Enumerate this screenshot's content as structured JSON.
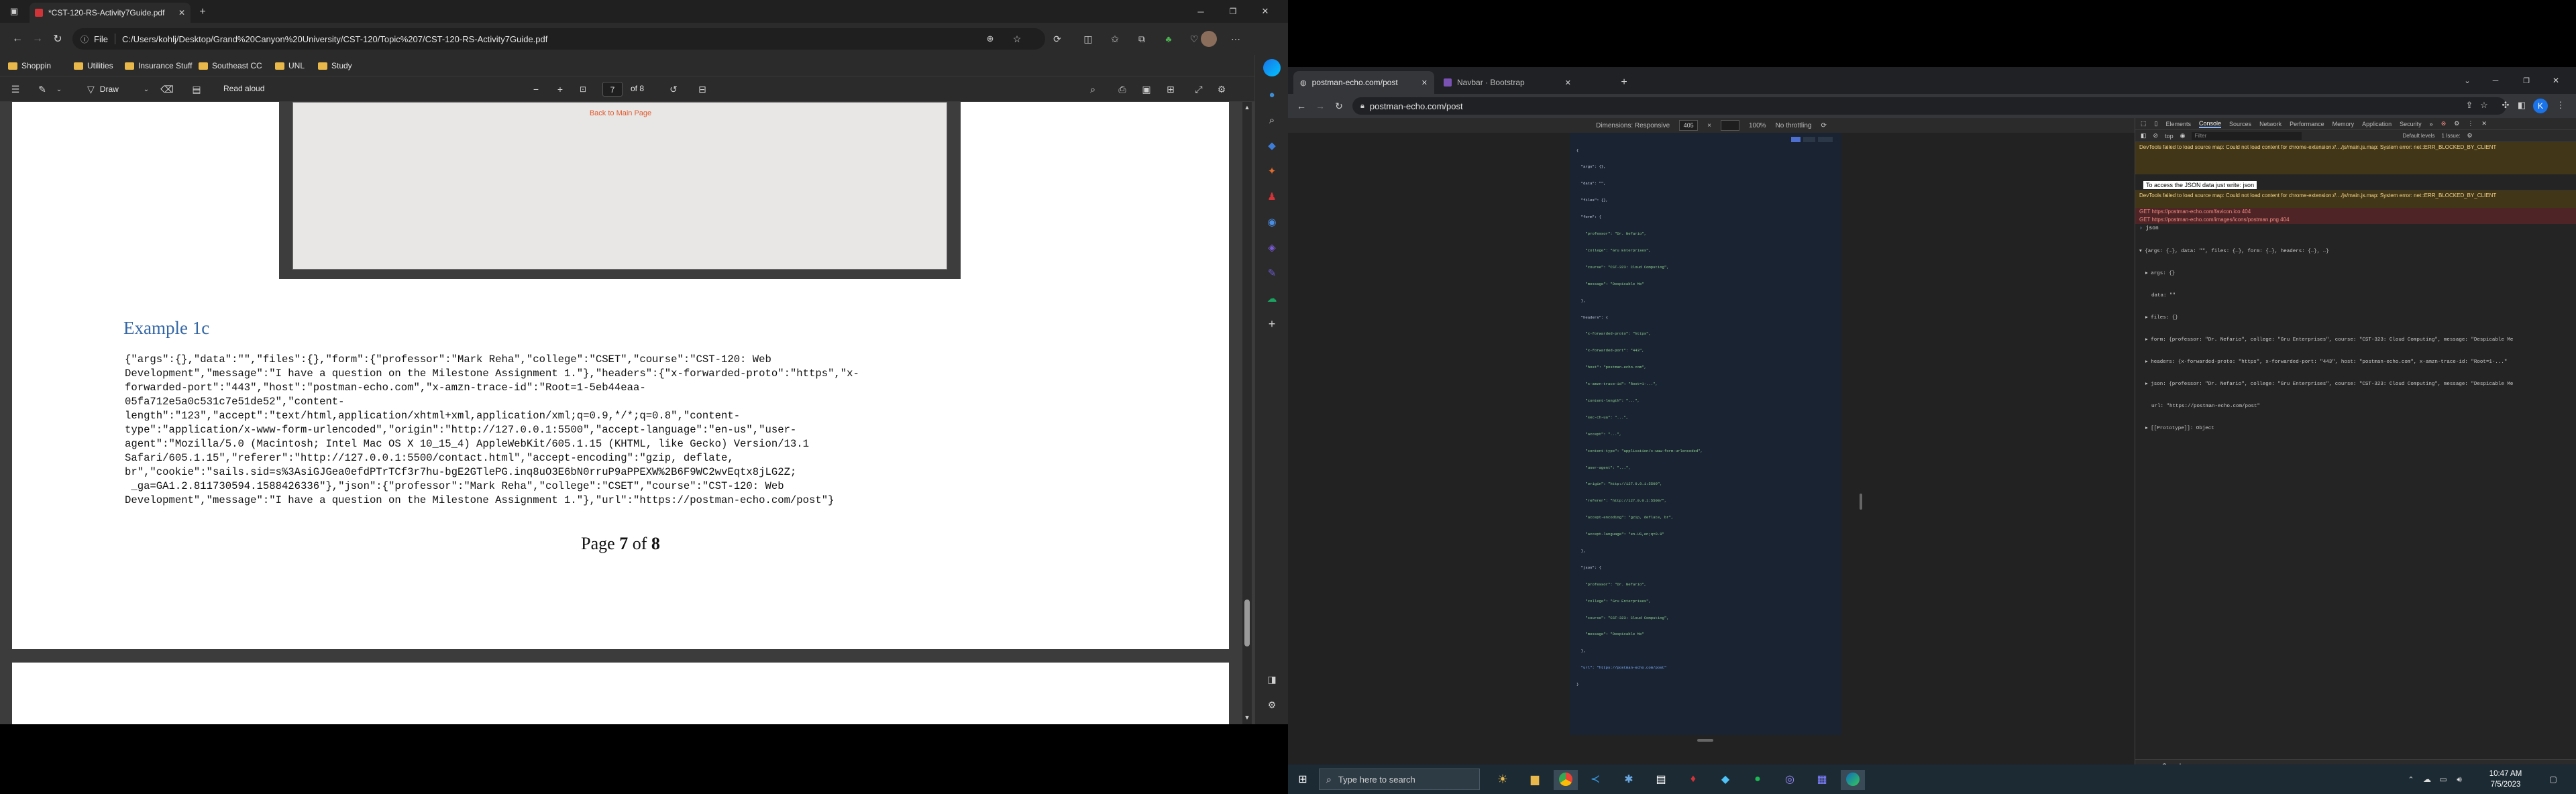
{
  "left": {
    "tab_title": "*CST-120-RS-Activity7Guide.pdf",
    "address_prefix": "File",
    "address": "C:/Users/kohlj/Desktop/Grand%20Canyon%20University/CST-120/Topic%207/CST-120-RS-Activity7Guide.pdf",
    "favorites": [
      "Shoppin",
      "Utilities",
      "Insurance Stuff",
      "Southeast CC",
      "UNL",
      "Study"
    ],
    "pdf_toolbar": {
      "draw_label": "Draw",
      "read_aloud_label": "Read aloud",
      "page_input": "7",
      "page_of": "of 8"
    },
    "embedded_link": "Back to Main Page",
    "example_heading": "Example 1c",
    "json_lines": [
      "{\"args\":{},\"data\":\"\",\"files\":{},\"form\":{\"professor\":\"Mark Reha\",\"college\":\"CSET\",\"course\":\"CST-120: Web",
      "Development\",\"message\":\"I have a question on the Milestone Assignment 1.\"},\"headers\":{\"x-forwarded-proto\":\"https\",\"x-",
      "forwarded-port\":\"443\",\"host\":\"postman-echo.com\",\"x-amzn-trace-id\":\"Root=1-5eb44eaa-",
      "05fa712e5a0c531c7e51de52\",\"content-",
      "length\":\"123\",\"accept\":\"text/html,application/xhtml+xml,application/xml;q=0.9,*/*;q=0.8\",\"content-",
      "type\":\"application/x-www-form-urlencoded\",\"origin\":\"http://127.0.0.1:5500\",\"accept-language\":\"en-us\",\"user-",
      "agent\":\"Mozilla/5.0 (Macintosh; Intel Mac OS X 10_15_4) AppleWebKit/605.1.15 (KHTML, like Gecko) Version/13.1",
      "Safari/605.1.15\",\"referer\":\"http://127.0.0.1:5500/contact.html\",\"accept-encoding\":\"gzip, deflate,",
      "br\",\"cookie\":\"sails.sid=s%3AsiGJGea0efdPTrTCf3r7hu-bgE2GTlePG.inq8uO3E6bN0rruP9aPPEXW%2B6F9WC2wvEqtx8jLG2Z;",
      " _ga=GA1.2.811730594.1588426336\"},\"json\":{\"professor\":\"Mark Reha\",\"college\":\"CSET\",\"course\":\"CST-120: Web",
      "Development\",\"message\":\"I have a question on the Milestone Assignment 1.\"},\"url\":\"https://postman-echo.com/post\"}"
    ],
    "page_footer": {
      "prefix": "Page ",
      "current": "7",
      "mid": " of ",
      "total": "8"
    }
  },
  "right": {
    "tabs": [
      "postman-echo.com/post",
      "Navbar · Bootstrap"
    ],
    "url": "postman-echo.com/post",
    "device_toolbar": {
      "dimensions": "Dimensions: Responsive",
      "width": "405",
      "zoom": "100%",
      "throttle": "No throttling"
    },
    "devtools_tabs": [
      "Elements",
      "Console",
      "Sources",
      "Network",
      "Performance",
      "Memory",
      "Application",
      "Security"
    ],
    "console_top": "top",
    "console_filter": "Filter",
    "console_levels": "Default levels",
    "console_issue": "1 Issue:",
    "console_warn1": "DevTools failed to load source map: Could not load content for chrome-extension://…/js/main.js.map: System error: net::ERR_BLOCKED_BY_CLIENT",
    "console_info": "To access the JSON data just write: json",
    "console_warn2": "DevTools failed to load source map: Could not load content for chrome-extension://…/js/main.js.map: System error: net::ERR_BLOCKED_BY_CLIENT",
    "console_err1": "GET https://postman-echo.com/favicon.ico 404",
    "console_err2": "GET https://postman-echo.com/images/icons/postman.png 404",
    "console_json_label": "json",
    "json_tree": [
      "▾ {args: {…}, data: \"\", files: {…}, form: {…}, headers: {…}, …}",
      "  ▸ args: {}",
      "    data: \"\"",
      "  ▸ files: {}",
      "  ▸ form: {professor: \"Dr. Nefario\", college: \"Gru Enterprises\", course: \"CST-323: Cloud Computing\", message: \"Despicable Me",
      "  ▸ headers: {x-forwarded-proto: \"https\", x-forwarded-port: \"443\", host: \"postman-echo.com\", x-amzn-trace-id: \"Root=1-...\"",
      "  ▸ json: {professor: \"Dr. Nefario\", college: \"Gru Enterprises\", course: \"CST-323: Cloud Computing\", message: \"Despicable Me",
      "    url: \"https://postman-echo.com/post\"",
      "  ▸ [[Prototype]]: Object"
    ],
    "console_drawer_tab": "Console",
    "page_json_lines": [
      "{",
      "  \"args\": {},",
      "  \"data\": \"\",",
      "  \"files\": {},",
      "  \"form\": {",
      "    \"professor\": \"Dr. Nefario\",",
      "    \"college\": \"Gru Enterprises\",",
      "    \"course\": \"CST-323: Cloud Computing\",",
      "    \"message\": \"Despicable Me\"",
      "  },",
      "  \"headers\": {",
      "    \"x-forwarded-proto\": \"https\",",
      "    \"x-forwarded-port\": \"443\",",
      "    \"host\": \"postman-echo.com\",",
      "    \"x-amzn-trace-id\": \"Root=1-...\",",
      "    \"content-length\": \"...\",",
      "    \"sec-ch-ua\": \"...\",",
      "    \"accept\": \"...\",",
      "    \"content-type\": \"application/x-www-form-urlencoded\",",
      "    \"user-agent\": \"...\",",
      "    \"origin\": \"http://127.0.0.1:5500\",",
      "    \"referer\": \"http://127.0.0.1:5500/\",",
      "    \"accept-encoding\": \"gzip, deflate, br\",",
      "    \"accept-language\": \"en-US,en;q=0.9\"",
      "  },",
      "  \"json\": {",
      "    \"professor\": \"Dr. Nefario\",",
      "    \"college\": \"Gru Enterprises\",",
      "    \"course\": \"CST-323: Cloud Computing\",",
      "    \"message\": \"Despicable Me\"",
      "  },",
      "  \"url\": \"https://postman-echo.com/post\"",
      "}"
    ]
  },
  "taskbar": {
    "search_placeholder": "Type here to search",
    "time": "10:47 AM",
    "date": "7/5/2023"
  }
}
